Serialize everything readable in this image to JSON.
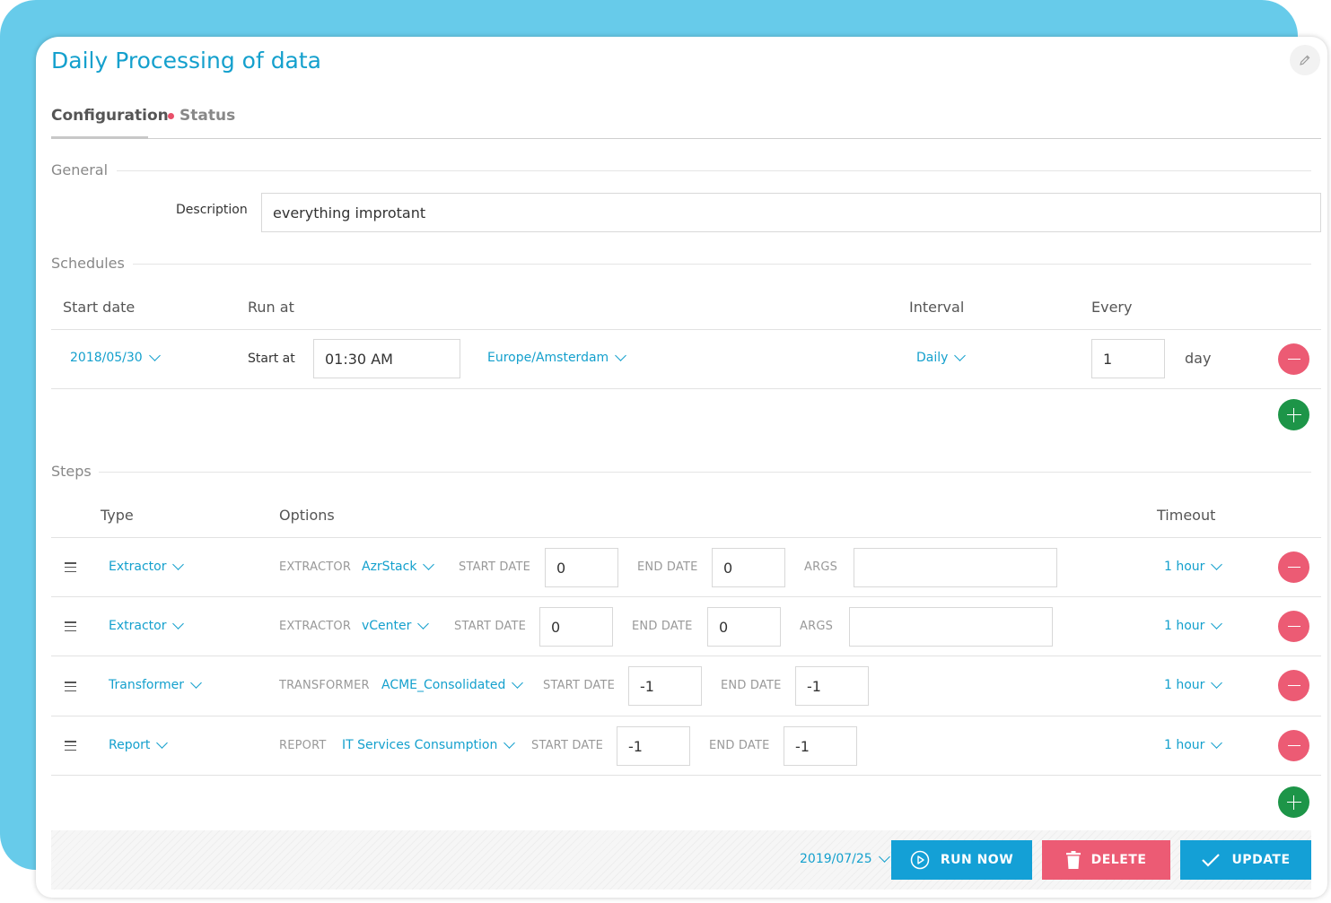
{
  "page": {
    "title": "Daily Processing of data"
  },
  "tabs": [
    {
      "label": "Configuration",
      "active": true
    },
    {
      "label": "Status",
      "active": false,
      "indicator_color": "#e9506a"
    }
  ],
  "general": {
    "section_label": "General",
    "description_label": "Description",
    "description_value": "everything improtant"
  },
  "schedules": {
    "section_label": "Schedules",
    "headers": {
      "start_date": "Start date",
      "run_at": "Run at",
      "interval": "Interval",
      "every": "Every"
    },
    "rows": [
      {
        "start_date": "2018/05/30",
        "start_at_label": "Start at",
        "time": "01:30 AM",
        "timezone": "Europe/Amsterdam",
        "interval": "Daily",
        "every_value": "1",
        "every_unit": "day"
      }
    ]
  },
  "steps": {
    "section_label": "Steps",
    "headers": {
      "type": "Type",
      "options": "Options",
      "timeout": "Timeout"
    },
    "rows": [
      {
        "type": "Extractor",
        "kind_label": "EXTRACTOR",
        "source": "AzrStack",
        "start_label": "START DATE",
        "start_value": "0",
        "end_label": "END DATE",
        "end_value": "0",
        "args_label": "ARGS",
        "args_value": "",
        "timeout": "1 hour"
      },
      {
        "type": "Extractor",
        "kind_label": "EXTRACTOR",
        "source": "vCenter",
        "start_label": "START DATE",
        "start_value": "0",
        "end_label": "END DATE",
        "end_value": "0",
        "args_label": "ARGS",
        "args_value": "",
        "timeout": "1 hour"
      },
      {
        "type": "Transformer",
        "kind_label": "TRANSFORMER",
        "source": "ACME_Consolidated",
        "start_label": "START DATE",
        "start_value": "-1",
        "end_label": "END DATE",
        "end_value": "-1",
        "timeout": "1 hour"
      },
      {
        "type": "Report",
        "kind_label": "REPORT",
        "source": "IT Services Consumption",
        "start_label": "START DATE",
        "start_value": "-1",
        "end_label": "END DATE",
        "end_value": "-1",
        "timeout": "1 hour"
      }
    ]
  },
  "footer": {
    "date": "2019/07/25",
    "run_now_label": "RUN NOW",
    "delete_label": "DELETE",
    "update_label": "UPDATE"
  },
  "icons": {
    "edit": "pencil-icon",
    "dropdown": "chevron-down-icon",
    "remove": "minus-icon",
    "add": "plus-icon",
    "drag": "drag-handle-icon",
    "run": "play-circle-icon",
    "delete": "trash-icon",
    "update": "check-icon"
  },
  "colors": {
    "accent": "#14a0cd",
    "backdrop": "#67cbea",
    "danger": "#ec5b74",
    "success": "#1d9548",
    "primary_button": "#14a0d6"
  }
}
